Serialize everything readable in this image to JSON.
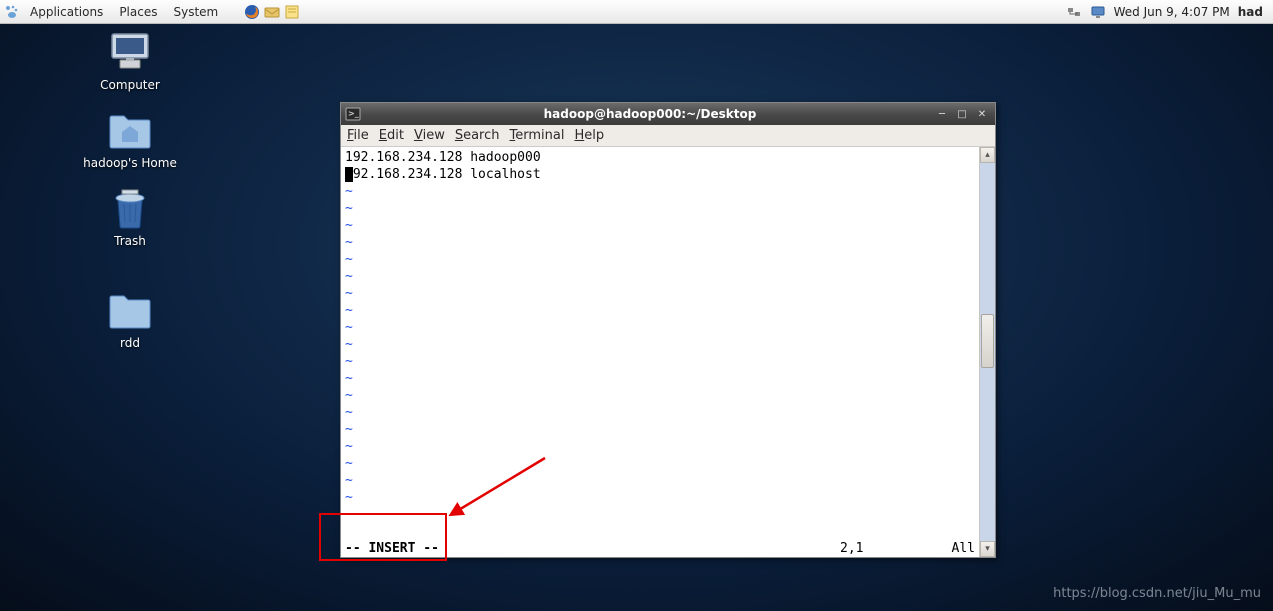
{
  "panel": {
    "menus": [
      "Applications",
      "Places",
      "System"
    ],
    "clock": "Wed Jun  9,  4:07 PM",
    "user": "had"
  },
  "desktop": {
    "icons": [
      {
        "label": "Computer",
        "kind": "computer"
      },
      {
        "label": "hadoop's Home",
        "kind": "home"
      },
      {
        "label": "Trash",
        "kind": "trash"
      },
      {
        "label": "rdd",
        "kind": "folder"
      }
    ]
  },
  "window": {
    "title": "hadoop@hadoop000:~/Desktop",
    "menus": [
      "File",
      "Edit",
      "View",
      "Search",
      "Terminal",
      "Help"
    ]
  },
  "terminal": {
    "lines": [
      "192.168.234.128 hadoop000",
      "192.168.234.128 localhost"
    ],
    "cursor_line": 1,
    "cursor_col": 0,
    "mode": "-- INSERT --",
    "position": "2,1",
    "view": "All"
  },
  "watermark": "https://blog.csdn.net/jiu_Mu_mu"
}
